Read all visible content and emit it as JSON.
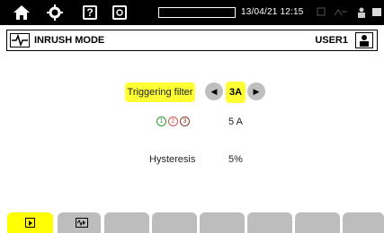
{
  "status_bar": {
    "datetime": "13/04/21 12:15",
    "help_glyph": "?",
    "progress_fraction": 0.0,
    "icons": [
      "home-icon",
      "settings-gear-icon",
      "help-icon",
      "screenshot-icon",
      "battery-icon"
    ]
  },
  "title_bar": {
    "mode_title": "INRUSH MODE",
    "user": "USER1"
  },
  "settings": {
    "trigger_label": "Triggering filter",
    "trigger_value": "3A",
    "phases": [
      "1",
      "2",
      "3"
    ],
    "phase_value": "5 A",
    "hysteresis_label": "Hysteresis",
    "hysteresis_value": "5%"
  },
  "colors": {
    "highlight": "#ffff33",
    "tab_inactive": "#bdbdbd",
    "phase1": "#2e9a2e",
    "phase2": "#d9534f",
    "phase3": "#8b3a2a"
  }
}
